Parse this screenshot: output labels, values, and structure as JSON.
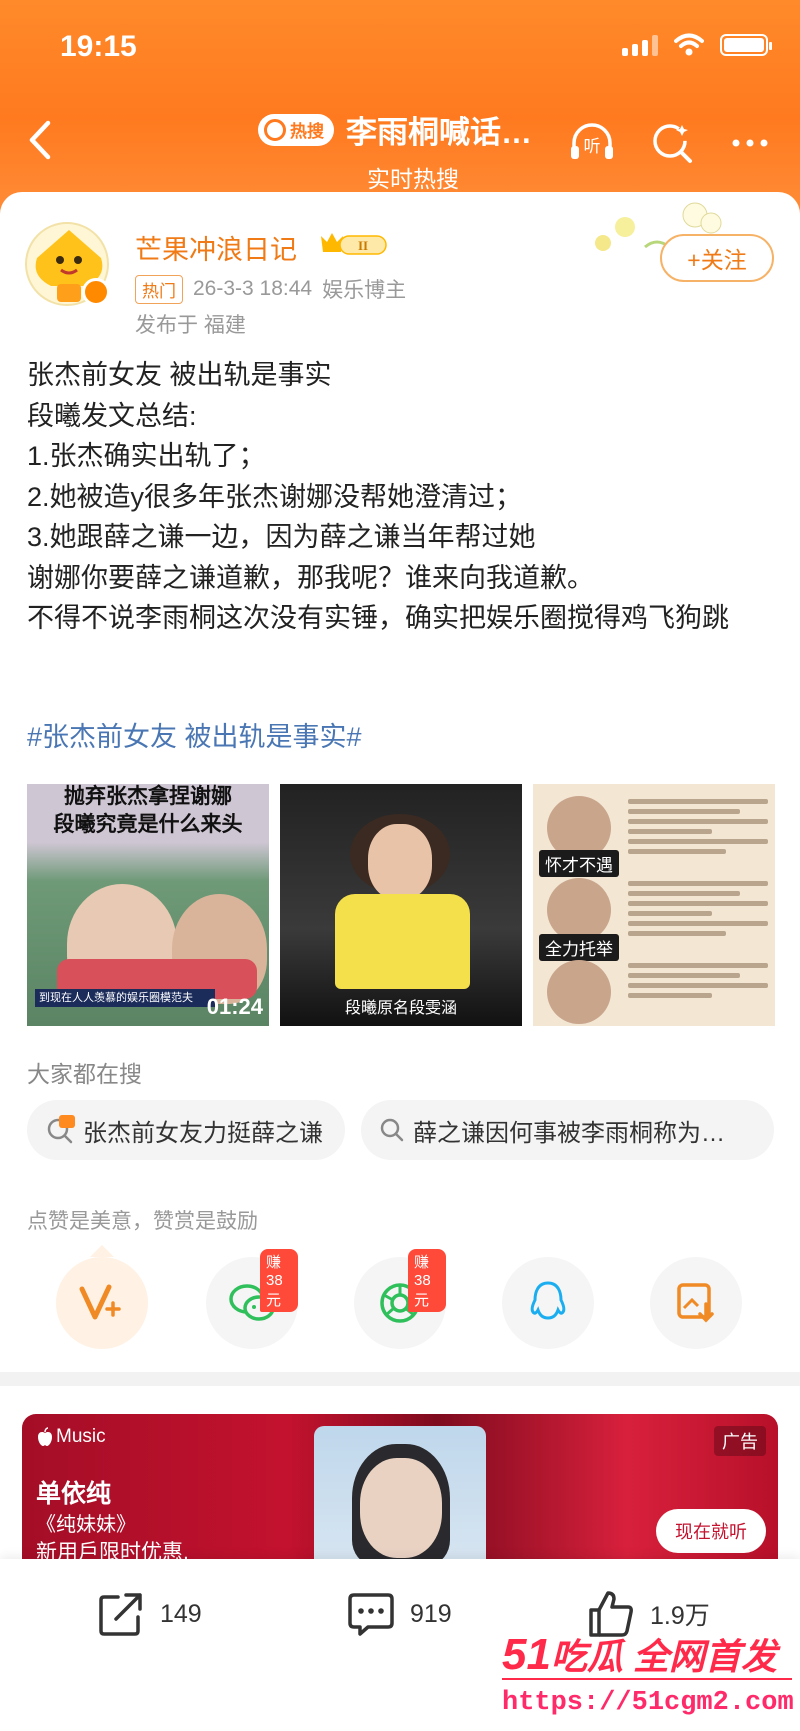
{
  "status_bar": {
    "time": "19:15"
  },
  "nav": {
    "hot_tag": "热搜",
    "title": "李雨桐喊话…",
    "subtitle": "实时热搜",
    "listen_icon_label": "听",
    "icons": [
      "back-icon",
      "listen-icon",
      "refresh-search-icon",
      "more-icon"
    ]
  },
  "post": {
    "author": "芒果冲浪日记",
    "level_badge": "II",
    "hot_label": "热门",
    "timestamp": "26-3-3 18:44",
    "role": "娱乐博主",
    "location": "发布于 福建",
    "follow_label": "+关注",
    "lines": [
      "张杰前女友 被出轨是事实",
      "段曦发文总结:",
      "1.张杰确实出轨了；",
      "2.她被造y很多年张杰谢娜没帮她澄清过；",
      "3.她跟薛之谦一边，因为薛之谦当年帮过她",
      "谢娜你要薛之谦道歉，那我呢？谁来向我道歉。",
      "不得不说李雨桐这次没有实锤，确实把娱乐圈搅得鸡飞狗跳"
    ],
    "topic": "#张杰前女友 被出轨是事实#",
    "images": [
      {
        "caption_top": "抛弃张杰拿捏谢娜",
        "caption_main": "段曦究竟是什么来头",
        "subtitle": "到现在人人羡慕的娱乐圈模范夫",
        "duration": "01:24"
      },
      {
        "subtitle": "段曦原名段雯涵"
      },
      {
        "tags": [
          "怀才不遇",
          "全力托举"
        ]
      }
    ]
  },
  "search": {
    "title": "大家都在搜",
    "chips": [
      "张杰前女友力挺薛之谦",
      "薛之谦因何事被李雨桐称为…"
    ]
  },
  "share": {
    "tip": "点赞是美意，赞赏是鼓励",
    "buttons": [
      {
        "icon": "reward-v-icon"
      },
      {
        "icon": "wechat-icon",
        "badge": "赚38元"
      },
      {
        "icon": "moments-icon",
        "badge": "赚38元"
      },
      {
        "icon": "qq-icon"
      },
      {
        "icon": "save-image-icon"
      }
    ]
  },
  "ad": {
    "brand": "Music",
    "artist": "单依纯",
    "album": "《纯妹妹》",
    "offer": "新用戶限时优惠,",
    "label": "广告",
    "button": "现在就听"
  },
  "actions": {
    "repost": "149",
    "comment": "919",
    "like": "1.9万"
  },
  "watermark": {
    "num": "51",
    "text": "吃瓜 全网首发",
    "url": "https://51cgm2.com"
  },
  "colors": {
    "accent": "#ff7a1f",
    "topic": "#4a77b4",
    "author": "#f07a16",
    "badge": "#ff4a3a"
  }
}
